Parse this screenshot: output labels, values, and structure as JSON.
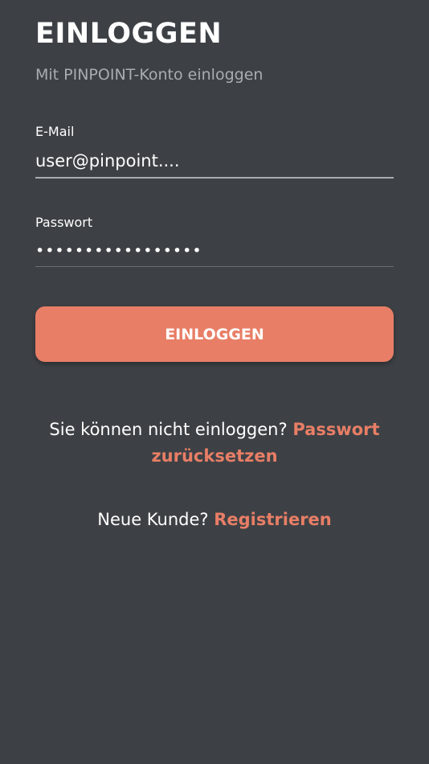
{
  "header": {
    "title": "EINLOGGEN",
    "subtitle": "Mit PINPOINT-Konto einloggen"
  },
  "form": {
    "email": {
      "label": "E-Mail",
      "value": "user@pinpoint...."
    },
    "password": {
      "label": "Passwort",
      "value": "•••••••••••••••••"
    },
    "submit_label": "EINLOGGEN"
  },
  "help": {
    "prompt": "Sie können nicht einloggen?",
    "link": "Passwort zurücksetzen"
  },
  "register": {
    "prompt": "Neue Kunde?",
    "link": "Registrieren"
  },
  "colors": {
    "background": "#3d4145",
    "accent": "#e87e66",
    "muted_text": "#a9acb0"
  }
}
